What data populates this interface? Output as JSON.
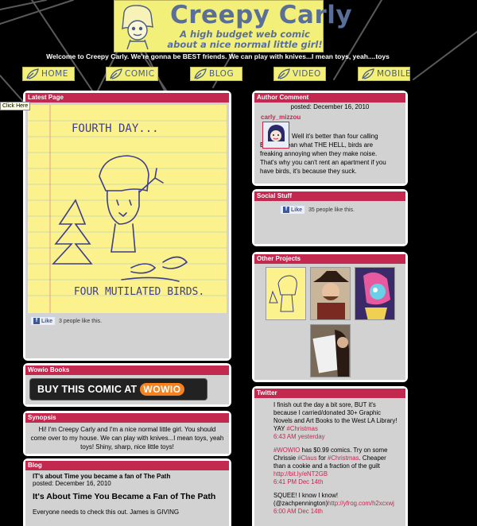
{
  "header": {
    "title": "Creepy Carly",
    "subtitle": "A high budget web comic about a nice normal little girl!",
    "welcome": "Welcome to Creepy Carly. We're gonna be BEST friends. We can play with knives...I mean toys, yeah....toys"
  },
  "nav": [
    {
      "label": "HOME"
    },
    {
      "label": "COMIC"
    },
    {
      "label": "BLOG"
    },
    {
      "label": "VIDEO"
    },
    {
      "label": "MOBILE"
    }
  ],
  "tooltip": "Click Here",
  "latest_page": {
    "title": "Latest Page",
    "comic_top_text": "FOURTH DAY...",
    "comic_bottom_text": "FOUR MUTILATED BIRDS.",
    "like_button": "Like",
    "like_count": "3 people like this."
  },
  "wowio": {
    "title": "Wowio Books",
    "button_text": "BUY THIS COMIC AT",
    "logo": "WOWIO"
  },
  "synopsis": {
    "title": "Synopsis",
    "text": "Hi! I'm Creepy Carly and I'm a nice normal little girl. You should come over to my house. We can play with knives...I mean toys, yeah toys! Shiny, sharp, nice little toys!"
  },
  "blog": {
    "title": "Blog",
    "post_link": "IT's about Time you became a fan of The Path",
    "post_date": "posted: December 16, 2010",
    "post_title": "It's About Time You Became a Fan of The Path",
    "post_body": "Everyone needs to check this out. James is GIVING"
  },
  "author_comment": {
    "title": "Author Comment",
    "date": "posted: December 16, 2010",
    "user": "carly_mizzou",
    "text_first": "Well it's better than four calling",
    "text_rest": "Birds, I mean what THE HELL, birds are freaking annoying when they make noise. That's why you can't rent an apartment if you have birds, it's because they suck."
  },
  "social": {
    "title": "Social Stuff",
    "like_button": "Like",
    "like_count": "35 people like this."
  },
  "other_projects": {
    "title": "Other Projects"
  },
  "twitter": {
    "title": "Twitter",
    "tweets": [
      {
        "text": "I finish out the day a bit sore, BUT it's because I carried/donated 30+ Graphic Novels and Art Books to the West LA Library! YAY ",
        "tag": "#Christmas",
        "time": "6:43 AM yesterday"
      },
      {
        "pre": "",
        "tag1": "#WOWIO",
        "mid": " has $0.99 comics. Try on some Chrissie ",
        "tag2": "#Claus",
        "mid2": " for ",
        "tag3": "#Christmas",
        "post": ". Cheaper than a cookie and a fraction of the guilt ",
        "link": "http://bit.ly/eNT2GB",
        "time": "6:41 PM Dec 14th"
      },
      {
        "text1": "SQUEE! I know I know!",
        "mention": "(@zachpennington)",
        "link": "http://yfrog.com/h2xcxwj",
        "time": "6:00 AM Dec 14th"
      }
    ]
  },
  "colors": {
    "accent": "#c3284f",
    "banner": "#f3f07a",
    "banner_text": "#5a6f98",
    "panel": "#d2d2d2"
  }
}
